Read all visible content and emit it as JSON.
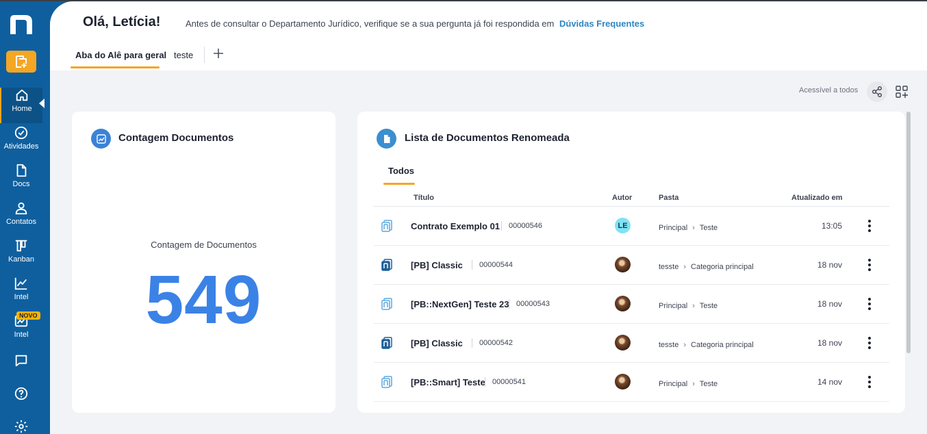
{
  "colors": {
    "sidebar": "#0f5f9e",
    "accent": "#f5a623",
    "link": "#2e86c1",
    "count": "#3b82e6"
  },
  "sidebar": {
    "new_doc_icon": "new-document-icon",
    "items": [
      {
        "label": "Home",
        "icon": "home-icon"
      },
      {
        "label": "Atividades",
        "icon": "check-circle-icon"
      },
      {
        "label": "Docs",
        "icon": "document-icon"
      },
      {
        "label": "Contatos",
        "icon": "user-icon"
      },
      {
        "label": "Kanban",
        "icon": "kanban-icon"
      },
      {
        "label": "Intel",
        "icon": "chart-line-icon"
      },
      {
        "label": "Intel",
        "icon": "chart-image-icon",
        "badge": "NOVO"
      },
      {
        "label": "",
        "icon": "chat-icon"
      },
      {
        "label": "",
        "icon": "help-icon"
      },
      {
        "label": "",
        "icon": "settings-icon"
      }
    ]
  },
  "header": {
    "greeting": "Olá, Letícia!",
    "notice": "Antes de consultar o Departamento Jurídico, verifique se a sua pergunta já foi respondida em",
    "notice_link": "Dúvidas Frequentes",
    "tabs": [
      {
        "label": "Aba do Alê para geral",
        "active": true
      },
      {
        "label": "teste",
        "active": false
      }
    ]
  },
  "toolbar": {
    "access_label": "Acessível a todos"
  },
  "count_card": {
    "title": "Contagem Documentos",
    "label": "Contagem de Documentos",
    "value": "549"
  },
  "list_card": {
    "title": "Lista de Documentos Renomeada",
    "subtab": "Todos",
    "columns": {
      "title": "Título",
      "author": "Autor",
      "folder": "Pasta",
      "updated": "Atualizado em"
    },
    "rows": [
      {
        "title": "Contrato Exemplo 01",
        "code": "00000546",
        "author": "LE",
        "author_type": "initials",
        "folder": "Principal",
        "subfolder": "Teste",
        "updated": "13:05",
        "icon_style": "light"
      },
      {
        "title": "[PB] Classic",
        "code": "00000544",
        "author": "",
        "author_type": "photo",
        "folder": "tesste",
        "subfolder": "Categoria principal",
        "updated": "18 nov",
        "icon_style": "dark"
      },
      {
        "title": "[PB::NextGen] Teste 23",
        "code": "00000543",
        "author": "",
        "author_type": "photo",
        "folder": "Principal",
        "subfolder": "Teste",
        "updated": "18 nov",
        "icon_style": "light"
      },
      {
        "title": "[PB] Classic",
        "code": "00000542",
        "author": "",
        "author_type": "photo",
        "folder": "tesste",
        "subfolder": "Categoria principal",
        "updated": "18 nov",
        "icon_style": "dark"
      },
      {
        "title": "[PB::Smart] Teste",
        "code": "00000541",
        "author": "",
        "author_type": "photo",
        "folder": "Principal",
        "subfolder": "Teste",
        "updated": "14 nov",
        "icon_style": "light"
      }
    ]
  }
}
